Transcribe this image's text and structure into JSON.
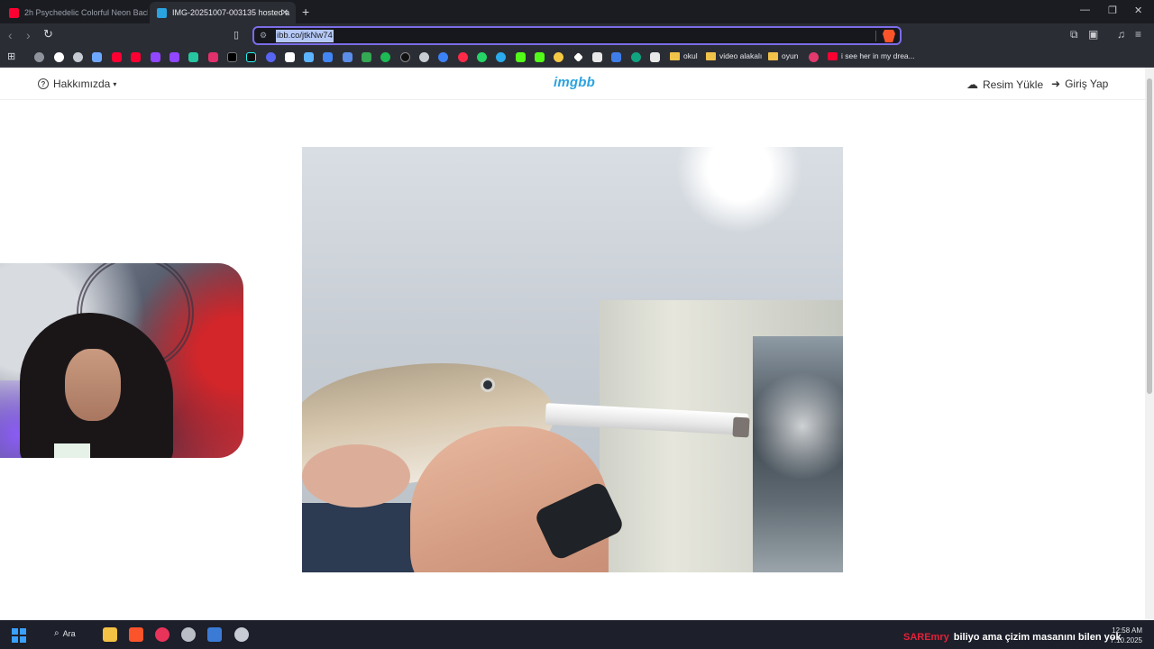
{
  "browser": {
    "tabs": [
      {
        "title": "2h Psychedelic Colorful Neon Backgr",
        "favicon": "youtube-icon",
        "active": false
      },
      {
        "title": "IMG-20251007-003135 hosted a",
        "favicon": "imgbb-icon",
        "active": true
      }
    ],
    "url": "ibb.co/jtkNw74",
    "bookmarks": [
      {
        "label": "okul"
      },
      {
        "label": "video alakalı"
      },
      {
        "label": "oyun"
      },
      {
        "label": "i see her in my drea..."
      }
    ]
  },
  "site": {
    "about_label": "Hakkımızda",
    "logo": "imgbb",
    "upload_label": "Resim Yükle",
    "login_label": "Giriş Yap"
  },
  "taskbar": {
    "search_label": "Ara",
    "ticker_user": "SAREmry",
    "ticker_text": "biliyo ama çizim masanını bilen yok",
    "time": "12:58 AM",
    "date": "7.10.2025"
  },
  "colors": {
    "accent": "#7b6ce8",
    "logo": "#2aa3df",
    "ticker_user": "#e2223a"
  }
}
